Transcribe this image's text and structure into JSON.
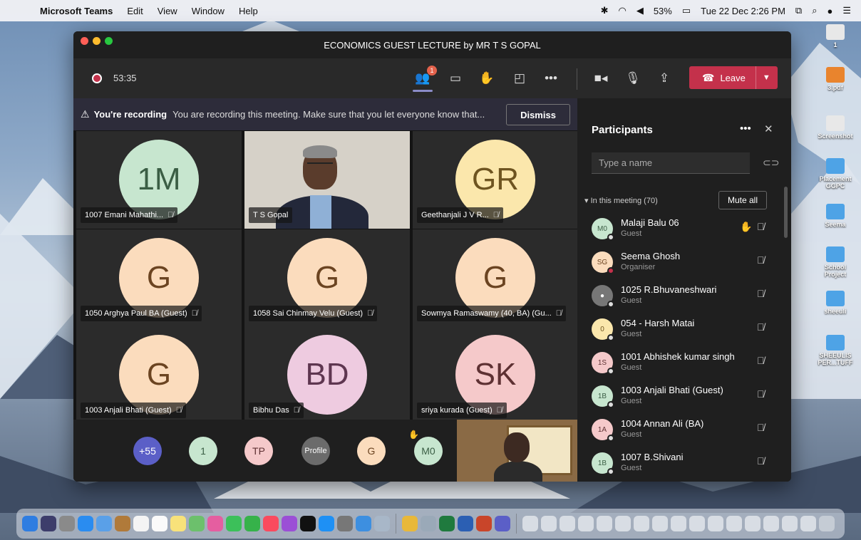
{
  "menubar": {
    "app": "Microsoft Teams",
    "items": [
      "Edit",
      "View",
      "Window",
      "Help"
    ],
    "battery": "53%",
    "datetime": "Tue 22 Dec  2:26 PM"
  },
  "desktop_icons": [
    {
      "label": "1",
      "kind": "file"
    },
    {
      "label": "3.pdf",
      "kind": "pdf"
    },
    {
      "label": "Screenshot",
      "kind": "file"
    },
    {
      "label": "Placement GGPC",
      "kind": "folder"
    },
    {
      "label": "Seema",
      "kind": "folder"
    },
    {
      "label": "School Project",
      "kind": "folder"
    },
    {
      "label": "sheeuli",
      "kind": "folder"
    },
    {
      "label": "SHEEULIS PER...TUFF",
      "kind": "folder"
    }
  ],
  "window": {
    "title": "ECONOMICS GUEST LECTURE by MR T S GOPAL"
  },
  "toolbar": {
    "timer": "53:35",
    "participants_badge": "1",
    "leave_label": "Leave"
  },
  "banner": {
    "title": "You're recording",
    "message": "You are recording this meeting. Make sure that you let everyone know that...",
    "dismiss_label": "Dismiss"
  },
  "tiles": [
    {
      "initials": "1M",
      "name": "1007 Emani Mahathi...",
      "color": "green"
    },
    {
      "initials": "",
      "name": "T S Gopal",
      "video": true
    },
    {
      "initials": "GR",
      "name": "Geethanjali J V R...",
      "color": "yellow"
    },
    {
      "initials": "G",
      "name": "1050 Arghya Paul BA (Guest)",
      "color": "peach"
    },
    {
      "initials": "G",
      "name": "1058 Sai Chinmay Velu (Guest)",
      "color": "peach"
    },
    {
      "initials": "G",
      "name": "Sowmya Ramaswamy (40, BA) (Gu...",
      "color": "peach"
    },
    {
      "initials": "G",
      "name": "1003 Anjali Bhati (Guest)",
      "color": "peach"
    },
    {
      "initials": "BD",
      "name": "Bibhu Das",
      "color": "pink"
    },
    {
      "initials": "SK",
      "name": "sriya kurada (Guest)",
      "color": "rose"
    }
  ],
  "strip": [
    {
      "label": "+55",
      "color": "purple"
    },
    {
      "label": "1",
      "color": "green"
    },
    {
      "label": "TP",
      "color": "rose"
    },
    {
      "label": "Profile",
      "color": "profile"
    },
    {
      "label": "G",
      "color": "peach"
    },
    {
      "label": "M0",
      "color": "green"
    }
  ],
  "panel": {
    "title": "Participants",
    "search_placeholder": "Type a name",
    "section": "In this meeting (70)",
    "mute_all": "Mute all",
    "participants": [
      {
        "initials": "M0",
        "name": "Malaji Balu 06",
        "role": "Guest",
        "color": "green",
        "hand": true,
        "status": "light"
      },
      {
        "initials": "SG",
        "name": "Seema Ghosh",
        "role": "Organiser",
        "color": "peach",
        "hand": false,
        "status": "red"
      },
      {
        "initials": "",
        "name": "1025 R.Bhuvaneshwari",
        "role": "Guest",
        "color": "gray",
        "hand": false,
        "status": "light"
      },
      {
        "initials": "0",
        "name": "054 - Harsh Matai",
        "role": "Guest",
        "color": "yellow",
        "hand": false,
        "status": "light"
      },
      {
        "initials": "1S",
        "name": "1001 Abhishek kumar singh",
        "role": "Guest",
        "color": "rose",
        "hand": false,
        "status": "light"
      },
      {
        "initials": "1B",
        "name": "1003 Anjali Bhati (Guest)",
        "role": "Guest",
        "color": "green",
        "hand": false,
        "status": "light"
      },
      {
        "initials": "1A",
        "name": "1004 Annan Ali (BA)",
        "role": "Guest",
        "color": "rose",
        "hand": false,
        "status": "light"
      },
      {
        "initials": "1B",
        "name": "1007 B.Shivani",
        "role": "Guest",
        "color": "green",
        "hand": false,
        "status": "light"
      }
    ]
  }
}
